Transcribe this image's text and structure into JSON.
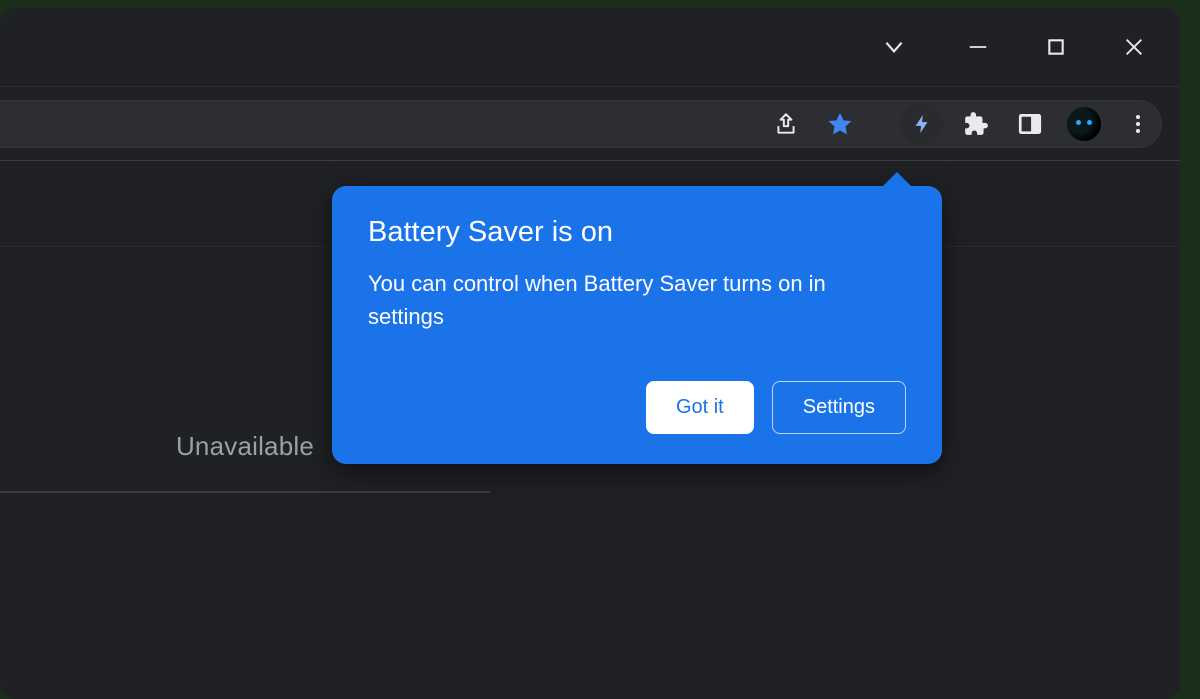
{
  "window_controls": {
    "chevron_icon": "chevron-down",
    "minimize_icon": "minimize",
    "maximize_icon": "maximize",
    "close_icon": "close"
  },
  "toolbar": {
    "share_icon": "share",
    "bookmark_icon": "star-filled",
    "battery_saver_icon": "lightning",
    "extensions_icon": "puzzle",
    "side_panel_icon": "side-panel",
    "profile_icon": "avatar",
    "menu_icon": "more-vertical"
  },
  "content": {
    "panel_status": "Unavailable"
  },
  "popover": {
    "title": "Battery Saver is on",
    "body": "You can control when Battery Saver turns on in settings",
    "primary_label": "Got it",
    "secondary_label": "Settings"
  },
  "colors": {
    "accent": "#1a73e8",
    "star_active": "#3b82f6",
    "lightning": "#8ab4f8"
  }
}
